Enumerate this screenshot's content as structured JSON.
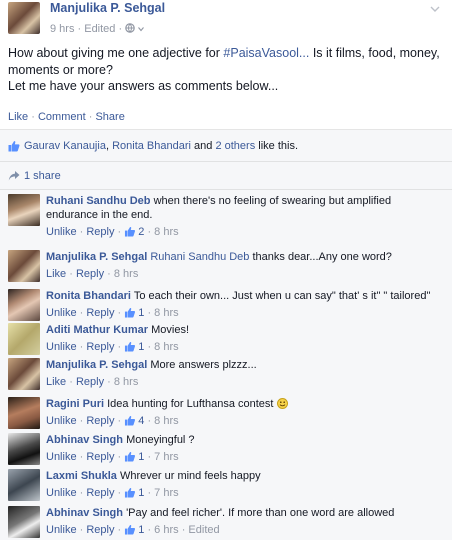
{
  "post": {
    "author": "Manjulika P. Sehgal",
    "meta": "9 hrs · Edited · ",
    "body": "How about giving me one adjective for #PaisaVasool... Is it films, food, money, moments or more?\nLet me have your answers as comments below...",
    "hashtag": "#PaisaVasool...",
    "actions": {
      "like": "Like",
      "comment": "Comment",
      "share": "Share"
    },
    "likes": {
      "name1": "Gaurav Kanaujia",
      "name2": "Ronita Bhandari",
      "and": "and",
      "others": "2 others",
      "tail": "like this."
    },
    "shares": "1 share"
  },
  "comments": [
    {
      "name": "Ruhani Sandhu Deb",
      "text": "when there's no feeling of swearing but amplified endurance in the end.",
      "like_label": "Unlike",
      "reply_label": "Reply",
      "likes": "2",
      "time": "8 hrs"
    },
    {
      "name": "Manjulika P. Sehgal",
      "mention": "Ruhani Sandhu Deb",
      "text": "thanks dear...Any one word?",
      "like_label": "Like",
      "reply_label": "Reply",
      "likes": "",
      "time": "8 hrs"
    },
    {
      "name": "Ronita Bhandari",
      "text": "To each their own... Just when u can say\" that' s it\" \" tailored\"",
      "like_label": "Unlike",
      "reply_label": "Reply",
      "likes": "1",
      "time": "8 hrs"
    },
    {
      "name": "Aditi Mathur Kumar",
      "text": "Movies!",
      "like_label": "Unlike",
      "reply_label": "Reply",
      "likes": "1",
      "time": "8 hrs"
    },
    {
      "name": "Manjulika P. Sehgal",
      "text": "More answers plzzz...",
      "like_label": "Like",
      "reply_label": "Reply",
      "likes": "",
      "time": "8 hrs"
    },
    {
      "name": "Ragini Puri",
      "text": "Idea hunting for Lufthansa contest",
      "like_label": "Unlike",
      "reply_label": "Reply",
      "likes": "4",
      "time": "8 hrs"
    },
    {
      "name": "Abhinav Singh",
      "text": "Moneyingful ?",
      "like_label": "Unlike",
      "reply_label": "Reply",
      "likes": "1",
      "time": "7 hrs"
    },
    {
      "name": "Laxmi Shukla",
      "text": "Whrever ur mind feels happy",
      "like_label": "Unlike",
      "reply_label": "Reply",
      "likes": "1",
      "time": "7 hrs"
    },
    {
      "name": "Abhinav Singh",
      "text": "'Pay and feel richer'. If more than one word are allowed",
      "like_label": "Unlike",
      "reply_label": "Reply",
      "likes": "1",
      "time": "6 hrs",
      "edited": "Edited"
    }
  ],
  "colors": {
    "link": "#3b5998",
    "muted": "#9197a3",
    "ufi_bg": "#f6f7f9"
  }
}
